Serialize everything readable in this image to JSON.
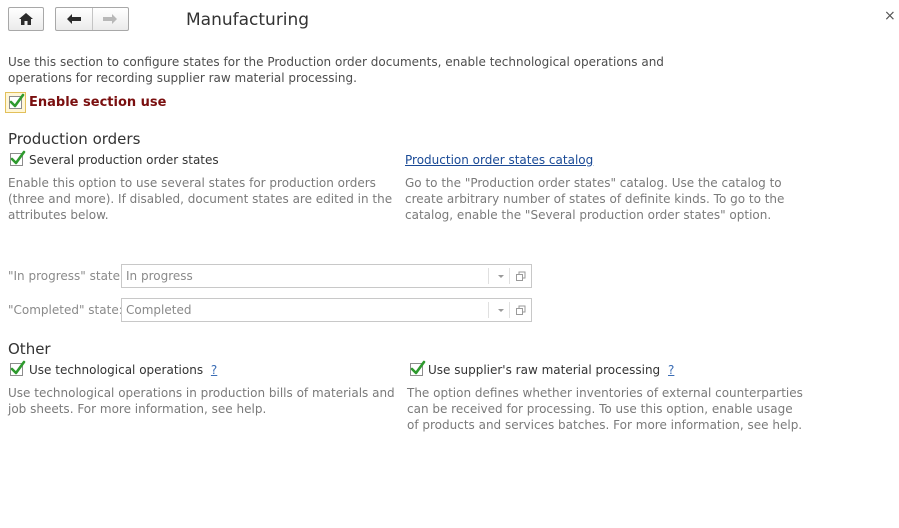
{
  "header": {
    "title": "Manufacturing",
    "close_glyph": "×"
  },
  "intro": {
    "text": "Use this section to configure states for the Production order documents, enable technological operations and operations for recording supplier raw material processing."
  },
  "enable_section": {
    "label": "Enable section use",
    "checked": true
  },
  "production_orders": {
    "heading": "Production orders",
    "several_states": {
      "label": "Several production order states",
      "checked": true,
      "hint": "Enable this option to use several states for production orders (three and more). If disabled, document states are edited in the attributes below."
    },
    "catalog": {
      "link": "Production order states catalog",
      "hint": "Go to the \"Production order states\" catalog. Use the catalog to create arbitrary number of states of definite kinds. To go to the catalog, enable the \"Several production order states\" option."
    },
    "in_progress": {
      "label": "\"In progress\" state:",
      "value": "In progress"
    },
    "completed": {
      "label": "\"Completed\" state:",
      "value": "Completed"
    }
  },
  "other": {
    "heading": "Other",
    "tech_ops": {
      "label": "Use technological operations",
      "help": "?",
      "checked": true,
      "hint": "Use technological operations in production bills of materials and job sheets. For more information, see help."
    },
    "raw_material": {
      "label": "Use supplier's raw material processing",
      "help": "?",
      "checked": true,
      "hint": "The option defines whether inventories of external counterparties can be received for processing. To use this option, enable usage of products and services batches. For more information, see help."
    }
  },
  "icons": {
    "home": "home-icon",
    "back": "arrow-left-icon",
    "forward": "arrow-right-icon",
    "check": "checkmark-icon",
    "dropdown": "chevron-down-icon",
    "open": "open-form-icon"
  },
  "colors": {
    "accent_check": "#2e9a2e",
    "enable_label": "#7a0f0f",
    "link": "#1a4a96",
    "hint_text": "#7a7a7a"
  }
}
